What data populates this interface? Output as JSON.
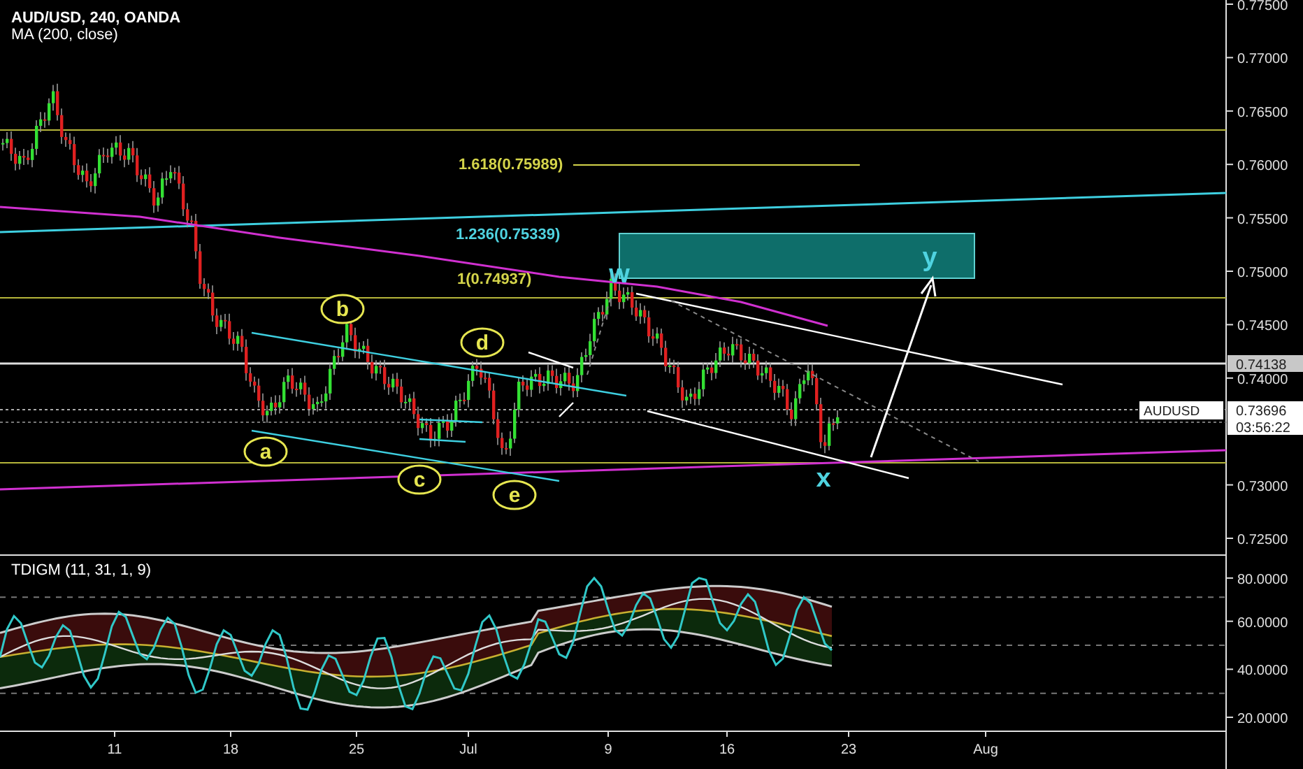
{
  "header": {
    "title": "AUD/USD, 240, OANDA",
    "study": "MA (200, close)"
  },
  "price_axis": {
    "ticks": [
      "0.77500",
      "0.77000",
      "0.76500",
      "0.76000",
      "0.75500",
      "0.75000",
      "0.74500",
      "0.74000",
      "0.73000",
      "0.72500"
    ]
  },
  "price_tags": [
    {
      "kind": "line",
      "text": "0.74138"
    },
    {
      "kind": "price",
      "text": "0.73696"
    },
    {
      "kind": "countdown",
      "text": "03:56:22"
    }
  ],
  "symbol_tag": "AUDUSD",
  "fib_levels": [
    {
      "text": "1.618(0.75989)",
      "color": "#d4d44a"
    },
    {
      "text": "1.236(0.75339)",
      "color": "#4fd3e0"
    },
    {
      "text": "1(0.74937)",
      "color": "#d4d44a"
    }
  ],
  "wave_labels": [
    {
      "text": "a",
      "kind": "circled"
    },
    {
      "text": "b",
      "kind": "circled"
    },
    {
      "text": "c",
      "kind": "circled"
    },
    {
      "text": "d",
      "kind": "circled"
    },
    {
      "text": "e",
      "kind": "circled"
    },
    {
      "text": "w",
      "kind": "plain"
    },
    {
      "text": "x",
      "kind": "plain"
    },
    {
      "text": "y",
      "kind": "plain"
    }
  ],
  "indicator": {
    "title": "TDIGM (11, 31, 1, 9)",
    "ticks": [
      "80.0000",
      "60.0000",
      "40.0000",
      "20.0000"
    ]
  },
  "time_axis": [
    "11",
    "18",
    "25",
    "Jul",
    "9",
    "16",
    "23",
    "Aug"
  ]
}
